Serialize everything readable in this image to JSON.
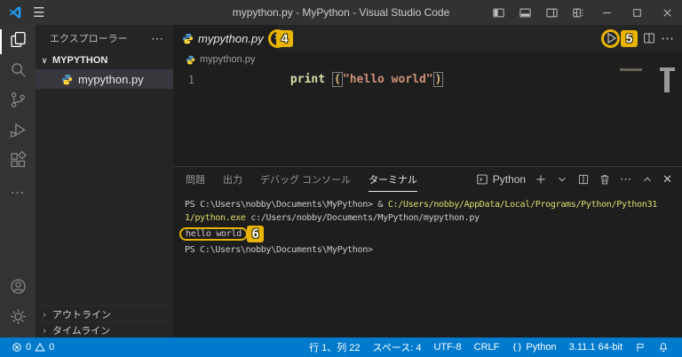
{
  "titlebar": {
    "title": "mypython.py - MyPython - Visual Studio Code"
  },
  "icons": {
    "menu": "☰",
    "more_horizontal": "⋯",
    "close": "✕",
    "chevron_down": "∨",
    "chevron_right": "›",
    "braces": "{}"
  },
  "sidebar": {
    "header": "エクスプローラー",
    "workspace": "MYPYTHON",
    "file": "mypython.py",
    "outline": "アウトライン",
    "timeline": "タイムライン"
  },
  "editor": {
    "tab_label": "mypython.py",
    "breadcrumb": "mypython.py",
    "line_number": "1",
    "code": {
      "keyword": "print",
      "open_paren": "(",
      "string": "\"hello world\"",
      "close_paren": ")"
    }
  },
  "panel": {
    "tabs": [
      "問題",
      "出力",
      "デバッグ コンソール",
      "ターミナル"
    ],
    "shell_label": "Python",
    "terminal": {
      "line1_prefix": "PS C:\\Users\\nobby\\Documents\\MyPython> & ",
      "line1_command": "C:/Users/nobby/AppData/Local/Programs/Python/Python31",
      "line2_command": "1/python.exe",
      "line2_args": " c:/Users/nobby/Documents/MyPython/mypython.py",
      "line3_output": "hello world",
      "line4_prompt": "PS C:\\Users\\nobby\\Documents\\MyPython>"
    }
  },
  "status_bar": {
    "errors": "0",
    "warnings": "0",
    "cursor_position": "行 1、列 22",
    "indentation": "スペース: 4",
    "encoding": "UTF-8",
    "eol": "CRLF",
    "language": "Python",
    "interpreter": "3.11.1 64-bit"
  },
  "annotations": {
    "close_tab_step": "4",
    "run_step": "5",
    "output_step": "6"
  },
  "colors": {
    "accent": "#007ACC",
    "annotation_yellow": "#E8B400",
    "keyword": "#DCDCAA",
    "string": "#CE9178",
    "terminal_command": "#DEDE6C"
  }
}
